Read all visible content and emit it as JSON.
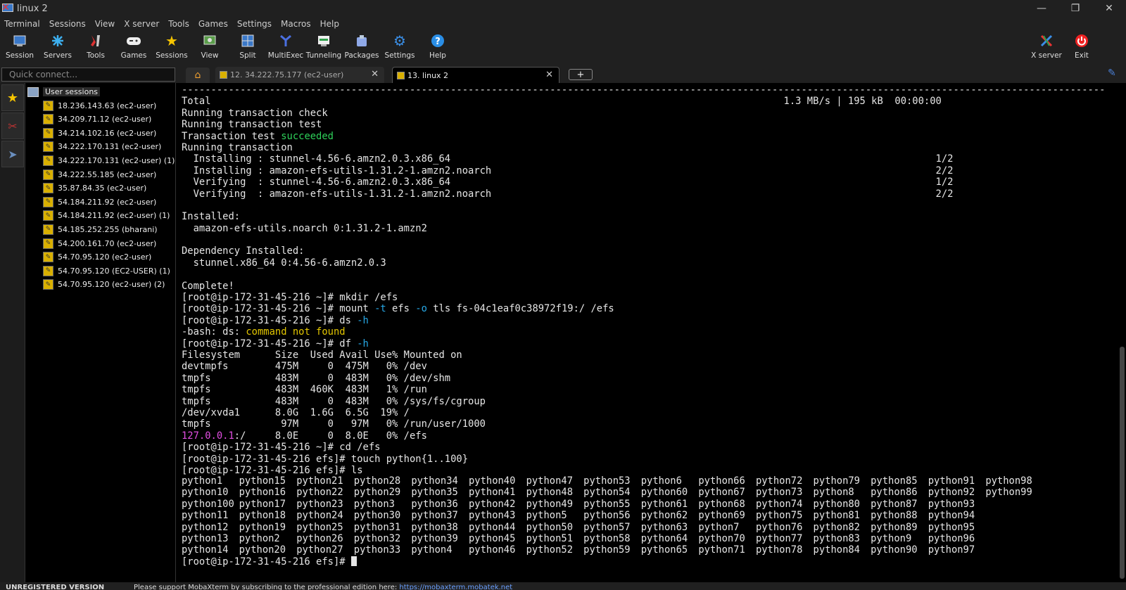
{
  "window": {
    "title": "linux 2"
  },
  "menu": [
    "Terminal",
    "Sessions",
    "View",
    "X server",
    "Tools",
    "Games",
    "Settings",
    "Macros",
    "Help"
  ],
  "toolbar": {
    "session": "Session",
    "servers": "Servers",
    "tools": "Tools",
    "games": "Games",
    "sessions": "Sessions",
    "view": "View",
    "split": "Split",
    "multiexec": "MultiExec",
    "tunneling": "Tunneling",
    "packages": "Packages",
    "settings": "Settings",
    "help": "Help",
    "xserver": "X server",
    "exit": "Exit"
  },
  "quick_connect": {
    "placeholder": "Quick connect..."
  },
  "tabs": [
    {
      "label": "12. 34.222.75.177 (ec2-user)"
    },
    {
      "label": "13. linux 2"
    }
  ],
  "sidebar": {
    "root": "User sessions",
    "sessions": [
      "18.236.143.63 (ec2-user)",
      "34.209.71.12 (ec2-user)",
      "34.214.102.16 (ec2-user)",
      "34.222.170.131 (ec2-user)",
      "34.222.170.131 (ec2-user) (1)",
      "34.222.55.185 (ec2-user)",
      "35.87.84.35 (ec2-user)",
      "54.184.211.92 (ec2-user)",
      "54.184.211.92 (ec2-user) (1)",
      "54.185.252.255 (bharani)",
      "54.200.161.70 (ec2-user)",
      "54.70.95.120 (ec2-user)",
      "54.70.95.120 (EC2-USER) (1)",
      "54.70.95.120 (ec2-user) (2)"
    ]
  },
  "terminal": {
    "separator": "--------------------------------------------------------------------------------------------------------------------------------------------------------------",
    "total_line": "Total                                                                                                  1.3 MB/s | 195 kB  00:00:00",
    "check": "Running transaction check",
    "test": "Running transaction test",
    "succ_pre": "Transaction test ",
    "succ": "succeeded",
    "running": "Running transaction",
    "inst1": "  Installing : stunnel-4.56-6.amzn2.0.3.x86_64                                                                                   1/2",
    "inst2": "  Installing : amazon-efs-utils-1.31.2-1.amzn2.noarch                                                                            2/2",
    "ver1": "  Verifying  : stunnel-4.56-6.amzn2.0.3.x86_64                                                                                   1/2",
    "ver2": "  Verifying  : amazon-efs-utils-1.31.2-1.amzn2.noarch                                                                            2/2",
    "installed_h": "Installed:",
    "installed_v": "  amazon-efs-utils.noarch 0:1.31.2-1.amzn2",
    "dep_h": "Dependency Installed:",
    "dep_v": "  stunnel.x86_64 0:4.56-6.amzn2.0.3",
    "complete": "Complete!",
    "prompt_home": "[root@ip-172-31-45-216 ~]# ",
    "prompt_efs": "[root@ip-172-31-45-216 efs]# ",
    "cmd_mkdir": "mkdir /efs",
    "cmd_mount_a": "mount ",
    "opt_t": "-t",
    "cmd_mount_b": " efs ",
    "opt_o": "-o",
    "cmd_mount_c": " tls fs-04c1eaf0c38972f19:/ /efs",
    "cmd_ds": "ds ",
    "opt_h": "-h",
    "bash_err_a": "-bash: ds: ",
    "bash_err_b": "command not found",
    "cmd_df": "df ",
    "df_header": "Filesystem      Size  Used Avail Use% Mounted on",
    "df_rows": [
      "devtmpfs        475M     0  475M   0% /dev",
      "tmpfs           483M     0  483M   0% /dev/shm",
      "tmpfs           483M  460K  483M   1% /run",
      "tmpfs           483M     0  483M   0% /sys/fs/cgroup",
      "/dev/xvda1      8.0G  1.6G  6.5G  19% /",
      "tmpfs            97M     0   97M   0% /run/user/1000"
    ],
    "df_last_ip": "127.0.0.1",
    "df_last_rest": ":/     8.0E     0  8.0E   0% /efs",
    "cmd_cd": "cd /efs",
    "cmd_touch": "touch python{1..100}",
    "cmd_ls": "ls",
    "ls_rows": [
      [
        "python1",
        "python15",
        "python21",
        "python28",
        "python34",
        "python40",
        "python47",
        "python53",
        "python6",
        "python66",
        "python72",
        "python79",
        "python85",
        "python91",
        "python98"
      ],
      [
        "python10",
        "python16",
        "python22",
        "python29",
        "python35",
        "python41",
        "python48",
        "python54",
        "python60",
        "python67",
        "python73",
        "python8",
        "python86",
        "python92",
        "python99"
      ],
      [
        "python100",
        "python17",
        "python23",
        "python3",
        "python36",
        "python42",
        "python49",
        "python55",
        "python61",
        "python68",
        "python74",
        "python80",
        "python87",
        "python93",
        ""
      ],
      [
        "python11",
        "python18",
        "python24",
        "python30",
        "python37",
        "python43",
        "python5",
        "python56",
        "python62",
        "python69",
        "python75",
        "python81",
        "python88",
        "python94",
        ""
      ],
      [
        "python12",
        "python19",
        "python25",
        "python31",
        "python38",
        "python44",
        "python50",
        "python57",
        "python63",
        "python7",
        "python76",
        "python82",
        "python89",
        "python95",
        ""
      ],
      [
        "python13",
        "python2",
        "python26",
        "python32",
        "python39",
        "python45",
        "python51",
        "python58",
        "python64",
        "python70",
        "python77",
        "python83",
        "python9",
        "python96",
        ""
      ],
      [
        "python14",
        "python20",
        "python27",
        "python33",
        "python4",
        "python46",
        "python52",
        "python59",
        "python65",
        "python71",
        "python78",
        "python84",
        "python90",
        "python97",
        ""
      ]
    ]
  },
  "status": {
    "unregistered": "UNREGISTERED VERSION",
    "support": "Please support MobaXterm by subscribing to the professional edition here: ",
    "link": "https://mobaxterm.mobatek.net"
  },
  "colors": {
    "green": "#2ed15a",
    "yellow": "#e3c600",
    "cyan": "#27a8e6",
    "magenta": "#e24ee2"
  }
}
